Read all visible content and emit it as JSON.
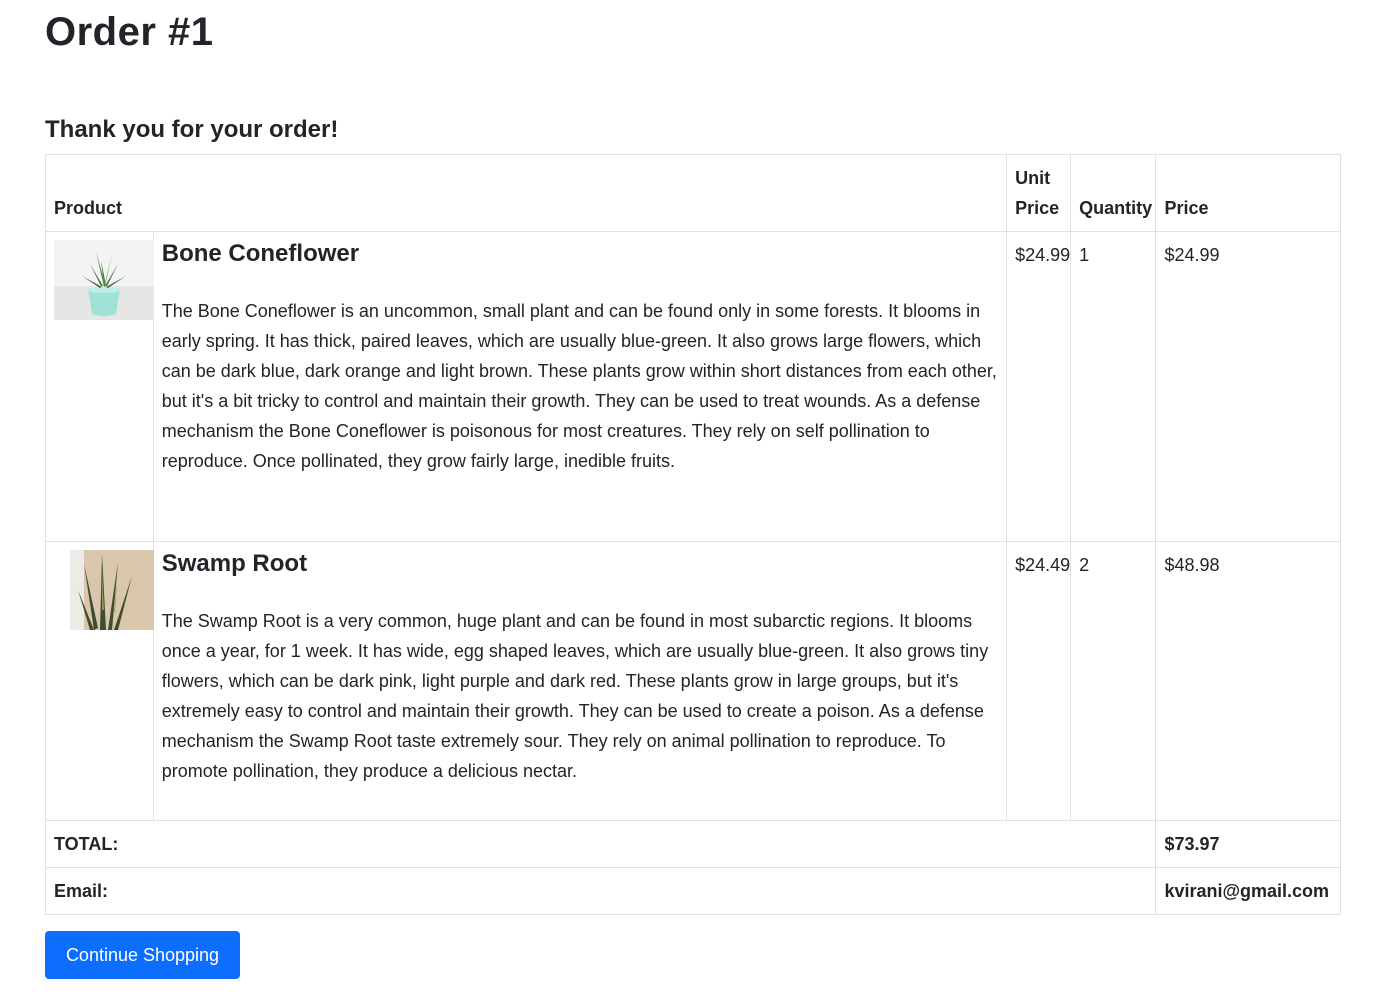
{
  "page": {
    "title": "Order #1",
    "subtitle": "Thank you for your order!"
  },
  "table": {
    "headers": {
      "product": "Product",
      "unit_price": "Unit Price",
      "quantity": "Quantity",
      "price": "Price"
    },
    "items": [
      {
        "image_icon": "potted-succulent-image",
        "name": "Bone Coneflower",
        "description": "The Bone Coneflower is an uncommon, small plant and can be found only in some forests. It blooms in early spring. It has thick, paired leaves, which are usually blue-green. It also grows large flowers, which can be dark blue, dark orange and light brown. These plants grow within short distances from each other, but it's a bit tricky to control and maintain their growth. They can be used to treat wounds. As a defense mechanism the Bone Coneflower is poisonous for most creatures. They rely on self pollination to reproduce. Once pollinated, they grow fairly large, inedible fruits.",
        "unit_price": "$24.99",
        "quantity": "1",
        "price": "$24.99"
      },
      {
        "image_icon": "snake-plant-image",
        "name": "Swamp Root",
        "description": "The Swamp Root is a very common, huge plant and can be found in most subarctic regions. It blooms once a year, for 1 week. It has wide, egg shaped leaves, which are usually blue-green. It also grows tiny flowers, which can be dark pink, light purple and dark red. These plants grow in large groups, but it's extremely easy to control and maintain their growth. They can be used to create a poison. As a defense mechanism the Swamp Root taste extremely sour. They rely on animal pollination to reproduce. To promote pollination, they produce a delicious nectar.",
        "unit_price": "$24.49",
        "quantity": "2",
        "price": "$48.98"
      }
    ],
    "total_label": "TOTAL:",
    "total_value": "$73.97",
    "email_label": "Email:",
    "email_value": "kvirani@gmail.com"
  },
  "actions": {
    "continue_label": "Continue Shopping"
  },
  "colors": {
    "primary": "#0d6efd",
    "text": "#212529",
    "border": "#dee2e6"
  }
}
